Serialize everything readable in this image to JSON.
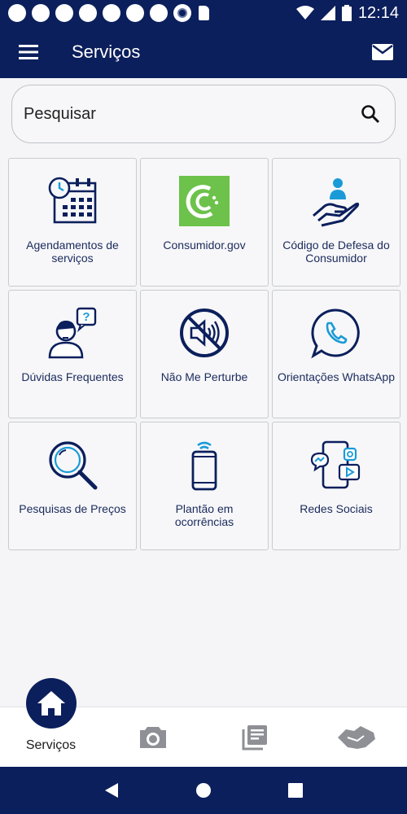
{
  "status_bar": {
    "time": "12:14"
  },
  "app_bar": {
    "title": "Serviços",
    "menu_icon": "menu-icon",
    "mail_icon": "mail-icon"
  },
  "search": {
    "placeholder": "Pesquisar"
  },
  "tiles": [
    {
      "label": "Agendamentos de serviços",
      "icon": "calendar-clock-icon"
    },
    {
      "label": "Consumidor.gov",
      "icon": "consumidor-gov-logo"
    },
    {
      "label": "Código de Defesa do Consumidor",
      "icon": "hand-person-icon"
    },
    {
      "label": "Dúvidas Frequentes",
      "icon": "question-person-icon"
    },
    {
      "label": "Não Me Perturbe",
      "icon": "mute-speaker-icon"
    },
    {
      "label": "Orientações WhatsApp",
      "icon": "whatsapp-icon"
    },
    {
      "label": "Pesquisas de Preços",
      "icon": "magnifier-icon"
    },
    {
      "label": "Plantão em ocorrências",
      "icon": "phone-signal-icon"
    },
    {
      "label": "Redes Sociais",
      "icon": "social-media-icon"
    }
  ],
  "bottom_nav": {
    "home_label": "Serviços",
    "items": [
      "home-icon",
      "camera-icon",
      "library-icon",
      "handshake-icon"
    ]
  },
  "colors": {
    "primary": "#0b1f5c",
    "accent": "#1a9bd7",
    "consumidor_green": "#6cc24a"
  }
}
